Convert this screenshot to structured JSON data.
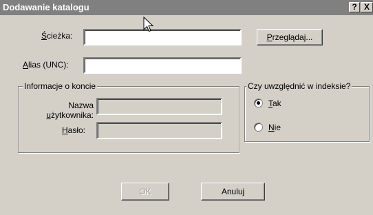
{
  "window": {
    "title": "Dodawanie katalogu",
    "help_glyph": "?",
    "close_glyph": "X"
  },
  "path": {
    "label_mnemonic": "Ś",
    "label_rest": "cieżka:",
    "value": ""
  },
  "browse_button": {
    "label_mnemonic": "P",
    "label_rest": "rzeglądaj..."
  },
  "alias": {
    "label_mnemonic": "A",
    "label_rest": "lias (UNC):",
    "value": ""
  },
  "account_group": {
    "title": "Informacje o koncie",
    "username_label_line1": "Nazwa",
    "username_label_line2_mnemonic": "u",
    "username_label_line2_rest": "żytkownika:",
    "username_value": "",
    "password_label_mnemonic": "H",
    "password_label_rest": "asło:",
    "password_value": ""
  },
  "index_group": {
    "title": "Czy uwzględnić w indeksie?",
    "options": [
      {
        "mnemonic": "T",
        "rest": "ak",
        "selected": true
      },
      {
        "mnemonic": "N",
        "rest": "ie",
        "selected": false
      }
    ]
  },
  "buttons": {
    "ok": "OK",
    "cancel": "Anuluj"
  },
  "colors": {
    "titlebar": "#808080",
    "face": "#d4d0c8"
  },
  "icons": {
    "cursor": "arrow-cursor-icon"
  }
}
